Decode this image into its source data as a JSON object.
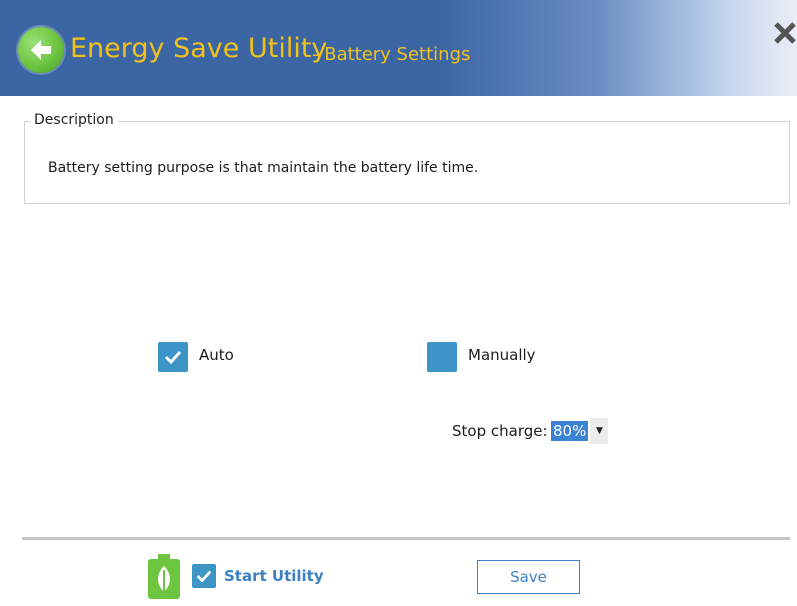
{
  "header": {
    "app_title": "Energy Save Utility",
    "page_subtitle": "- Battery Settings",
    "back_icon": "back-arrow-icon",
    "close_icon": "close-icon"
  },
  "description": {
    "legend": "Description",
    "text": "Battery setting purpose is that maintain the battery life time."
  },
  "options": {
    "auto": {
      "label": "Auto",
      "checked": true
    },
    "manually": {
      "label": "Manually",
      "checked": false
    }
  },
  "stop_charge": {
    "label": "Stop charge:",
    "value": "80%"
  },
  "footer": {
    "start_utility_label": "Start Utility",
    "start_utility_checked": true,
    "save_label": "Save"
  },
  "colors": {
    "title_text": "#f2c21b",
    "header_bg": "#3b65a3",
    "accent": "#3d94c7",
    "selection": "#3b82d4"
  }
}
